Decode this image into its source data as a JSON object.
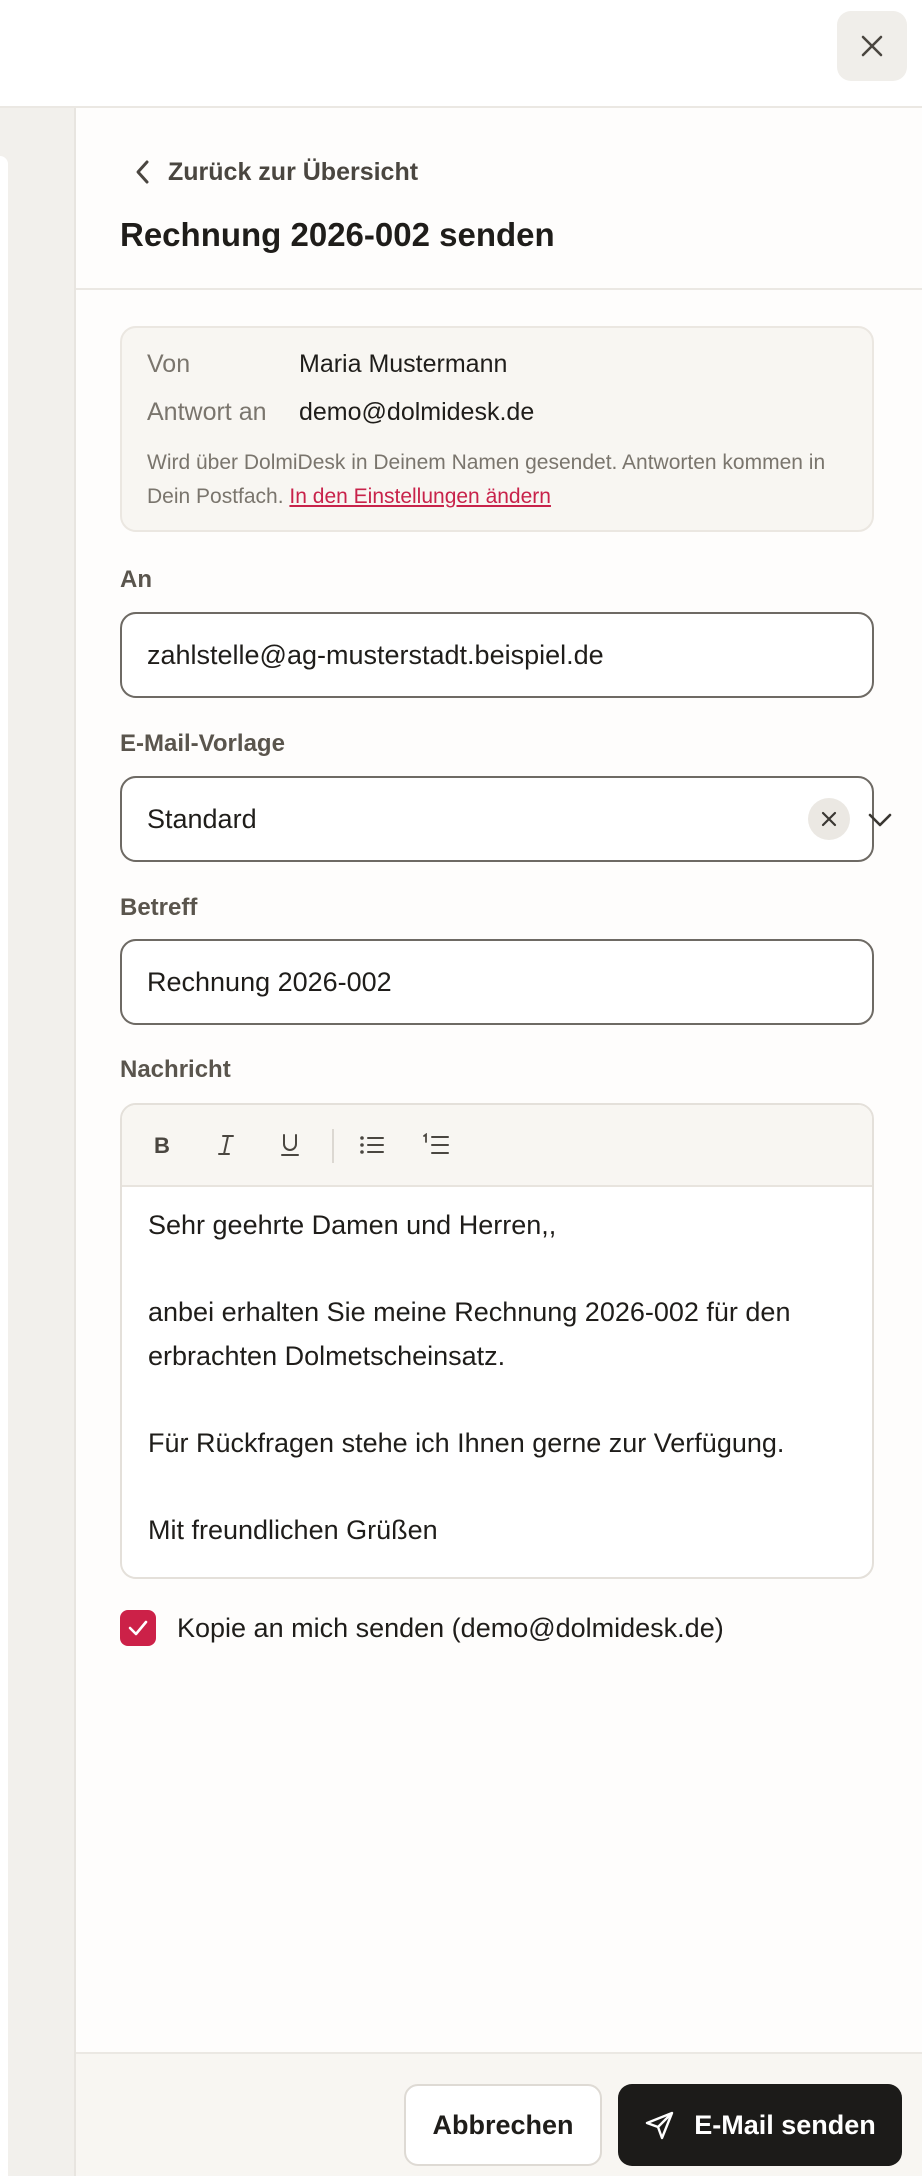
{
  "header": {
    "close_icon": "close-icon"
  },
  "panel": {
    "back_label": "Zurück zur Übersicht",
    "title": "Rechnung 2026-002 senden"
  },
  "sender_info": {
    "from_label": "Von",
    "from_value": "Maria Mustermann",
    "reply_label": "Antwort an",
    "reply_value": "demo@dolmidesk.de",
    "note": "Wird über DolmiDesk in Deinem Namen gesendet. Antworten kommen in Dein Postfach.",
    "settings_link": "In den Einstellungen ändern"
  },
  "to": {
    "label": "An",
    "value": "zahlstelle@ag-musterstadt.beispiel.de"
  },
  "template": {
    "label": "E-Mail-Vorlage",
    "value": "Standard"
  },
  "subject": {
    "label": "Betreff",
    "value": "Rechnung 2026-002"
  },
  "message": {
    "label": "Nachricht",
    "toolbar": [
      "bold-icon",
      "italic-icon",
      "underline-icon",
      "bullet-list-icon",
      "numbered-list-icon"
    ],
    "paragraphs": [
      "Sehr geehrte Damen und Herren,,",
      "anbei erhalten Sie meine Rechnung 2026-002 für den erbrachten Dolmetscheinsatz.",
      "Für Rückfragen stehe ich Ihnen gerne zur Verfügung.",
      "Mit freundlichen Grüßen"
    ]
  },
  "copy_to_me": {
    "label": "Kopie an mich senden (demo@dolmidesk.de)",
    "checked": true
  },
  "footer": {
    "cancel_label": "Abbrechen",
    "send_label": "E-Mail senden"
  },
  "colors": {
    "accent": "#cc2148",
    "primary_button": "#1c1b19"
  }
}
